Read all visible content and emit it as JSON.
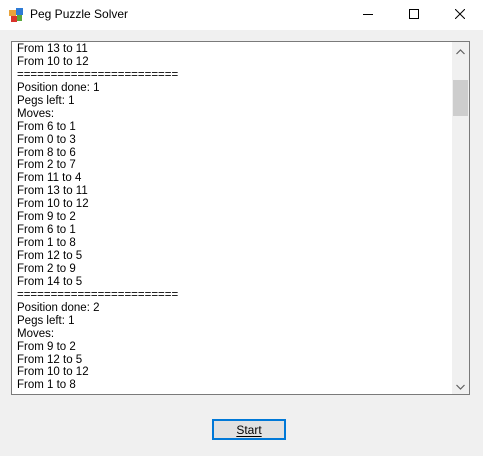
{
  "window": {
    "title": "Peg Puzzle Solver",
    "icon": "app-icon"
  },
  "title_controls": {
    "minimize_icon": "minimize-icon",
    "maximize_icon": "maximize-icon",
    "close_icon": "close-icon"
  },
  "output": {
    "lines": [
      "From 13 to 11",
      "From 10 to 12",
      "========================",
      "Position done: 1",
      "Pegs left: 1",
      "Moves:",
      "From 6 to 1",
      "From 0 to 3",
      "From 8 to 6",
      "From 2 to 7",
      "From 11 to 4",
      "From 13 to 11",
      "From 10 to 12",
      "From 9 to 2",
      "From 6 to 1",
      "From 1 to 8",
      "From 12 to 5",
      "From 2 to 9",
      "From 14 to 5",
      "========================",
      "Position done: 2",
      "Pegs left: 1",
      "Moves:",
      "From 9 to 2",
      "From 12 to 5",
      "From 10 to 12",
      "From 1 to 8"
    ]
  },
  "scrollbar": {
    "up_icon": "chevron-up-icon",
    "down_icon": "chevron-down-icon"
  },
  "start_button": {
    "label": "Start"
  }
}
